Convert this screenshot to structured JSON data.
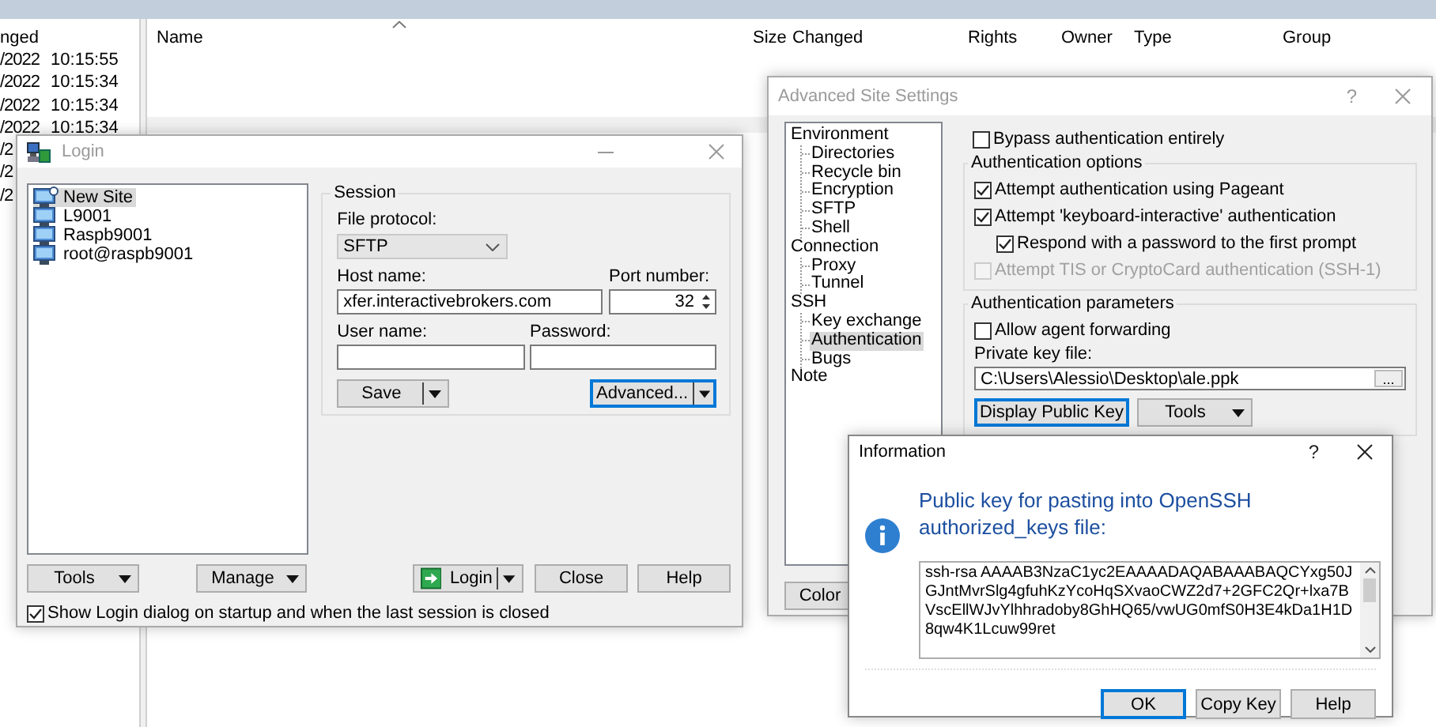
{
  "file_panels": {
    "left": {
      "column_header": "nged",
      "rows": [
        {
          "date": "/2022",
          "time": "10:15:55"
        },
        {
          "date": "/2022",
          "time": "10:15:34"
        },
        {
          "date": "/2022",
          "time": "10:15:34"
        },
        {
          "date": "/2022",
          "time": "10:15:34"
        },
        {
          "date": "/2"
        },
        {
          "date": "/2"
        },
        {
          "date": "/2"
        }
      ]
    },
    "right": {
      "columns": [
        {
          "label": "Name",
          "sorted": true
        },
        {
          "label": "Size",
          "sorted": false
        },
        {
          "label": "Changed",
          "sorted": false
        },
        {
          "label": "Rights",
          "sorted": false
        },
        {
          "label": "Owner",
          "sorted": false
        },
        {
          "label": "Type",
          "sorted": false
        },
        {
          "label": "Group",
          "sorted": false
        }
      ]
    }
  },
  "login_dialog": {
    "title": "Login",
    "active": false,
    "sites": [
      {
        "label": "New Site",
        "kind": "new",
        "selected": true
      },
      {
        "label": "L9001",
        "kind": "saved",
        "selected": false
      },
      {
        "label": "Raspb9001",
        "kind": "saved",
        "selected": false
      },
      {
        "label": "root@raspb9001",
        "kind": "saved",
        "selected": false
      }
    ],
    "session": {
      "group_label": "Session",
      "file_protocol_label": "File protocol:",
      "file_protocol": "SFTP",
      "host_label": "Host name:",
      "host": "xfer.interactivebrokers.com",
      "port_label": "Port number:",
      "port": "32",
      "user_label": "User name:",
      "password_label": "Password:",
      "buttons": [
        {
          "label": "Save",
          "focused": false
        },
        {
          "label": "Advanced...",
          "focused": true
        }
      ]
    },
    "buttons": [
      {
        "label": "Tools",
        "kind": "dropdown"
      },
      {
        "label": "Manage",
        "kind": "dropdown"
      },
      {
        "label": "Login",
        "kind": "split"
      },
      {
        "label": "Close",
        "kind": "plain"
      },
      {
        "label": "Help",
        "kind": "plain"
      }
    ],
    "show_on_startup": {
      "label": "Show Login dialog on startup and when the last session is closed",
      "checked": true
    }
  },
  "advanced_dialog": {
    "title": "Advanced Site Settings",
    "help": "?",
    "active": false,
    "tree": [
      {
        "label": "Environment",
        "selected": false,
        "children": [
          {
            "label": "Directories",
            "selected": false
          },
          {
            "label": "Recycle bin",
            "selected": false
          },
          {
            "label": "Encryption",
            "selected": false
          },
          {
            "label": "SFTP",
            "selected": false
          },
          {
            "label": "Shell",
            "selected": false
          }
        ]
      },
      {
        "label": "Connection",
        "selected": false,
        "children": [
          {
            "label": "Proxy",
            "selected": false
          },
          {
            "label": "Tunnel",
            "selected": false
          }
        ]
      },
      {
        "label": "SSH",
        "selected": false,
        "children": [
          {
            "label": "Key exchange",
            "selected": false
          },
          {
            "label": "Authentication",
            "selected": true
          },
          {
            "label": "Bugs",
            "selected": false
          }
        ]
      },
      {
        "label": "Note",
        "selected": false
      }
    ],
    "bypass": {
      "label": "Bypass authentication entirely",
      "checked": false,
      "disabled": false
    },
    "options_group": {
      "label": "Authentication options",
      "items": [
        {
          "label": "Attempt authentication using Pageant",
          "checked": true,
          "disabled": false
        },
        {
          "label": "Attempt 'keyboard-interactive' authentication",
          "checked": true,
          "disabled": false,
          "children": [
            {
              "label": "Respond with a password to the first prompt",
              "checked": true,
              "disabled": false
            }
          ]
        },
        {
          "label": "Attempt TIS or CryptoCard authentication (SSH-1)",
          "checked": false,
          "disabled": true
        }
      ]
    },
    "params_group": {
      "label": "Authentication parameters",
      "agent_forwarding": {
        "label": "Allow agent forwarding",
        "checked": false,
        "disabled": false
      },
      "key_file_label": "Private key file:",
      "key_file": "C:\\Users\\Alessio\\Desktop\\ale.ppk",
      "browse": "...",
      "buttons": [
        {
          "label": "Display Public Key",
          "kind": "plain",
          "focused": true
        },
        {
          "label": "Tools",
          "kind": "dropdown",
          "focused": false
        }
      ]
    },
    "bottom_button": "Color"
  },
  "info_dialog": {
    "title": "Information",
    "help": "?",
    "message": "Public key for pasting into OpenSSH authorized_keys file:",
    "key_text": "ssh-rsa AAAAB3NzaC1yc2EAAAADAQABAAABAQCYxg50JGJntMvrSlg4gfuhKzYcoHqSXvaoCWZ2d7+2GFC2Qr+lxa7BVscEllWJvYlhhradoby8GhHQ65/vwUG0mfS0H3E4kDa1H1D8qw4K1Lcuw99ret",
    "buttons": [
      {
        "label": "OK",
        "focused": true
      },
      {
        "label": "Copy Key",
        "focused": false
      },
      {
        "label": "Help",
        "focused": false
      }
    ]
  }
}
